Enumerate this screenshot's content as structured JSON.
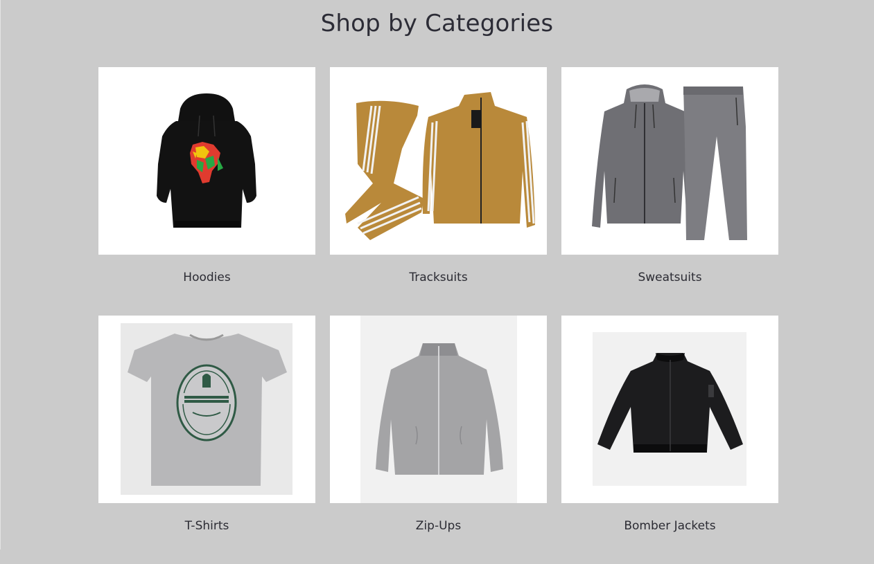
{
  "page": {
    "title": "Shop by Categories"
  },
  "categories": [
    {
      "label": "Hoodies",
      "icon": "hoodie-image"
    },
    {
      "label": "Tracksuits",
      "icon": "tracksuit-image"
    },
    {
      "label": "Sweatsuits",
      "icon": "sweatsuit-image"
    },
    {
      "label": "T-Shirts",
      "icon": "tshirt-image"
    },
    {
      "label": "Zip-Ups",
      "icon": "zip-up-image"
    },
    {
      "label": "Bomber Jackets",
      "icon": "bomber-jacket-image"
    }
  ],
  "colors": {
    "background": "#cbcbcb",
    "card": "#ffffff",
    "text": "#2b2b33"
  }
}
